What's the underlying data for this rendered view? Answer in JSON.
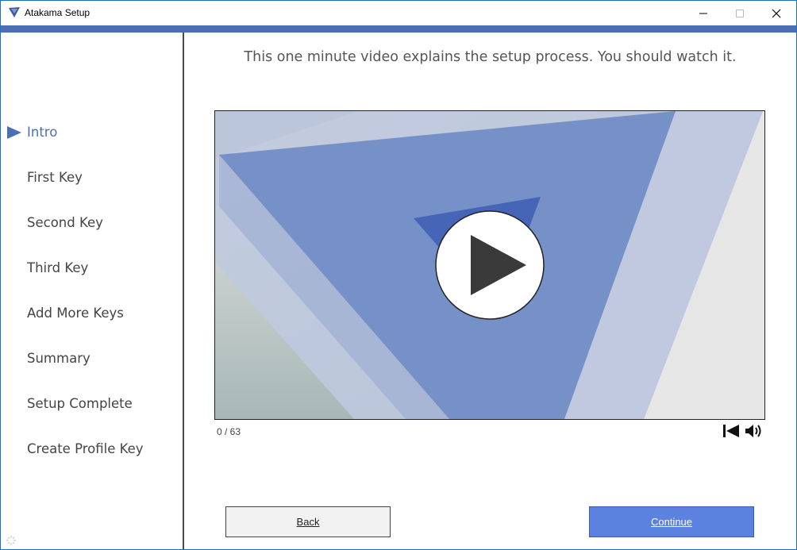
{
  "window": {
    "title": "Atakama Setup",
    "minimize_glyph": "—",
    "maximize_glyph": "☐",
    "close_glyph": "✕"
  },
  "colors": {
    "accent": "#4a6fb5",
    "continue_button": "#5b82de",
    "active_step": "#4a6fb5"
  },
  "sidebar": {
    "steps": [
      {
        "label": "Intro",
        "active": true
      },
      {
        "label": "First Key",
        "active": false
      },
      {
        "label": "Second Key",
        "active": false
      },
      {
        "label": "Third Key",
        "active": false
      },
      {
        "label": "Add More Keys",
        "active": false
      },
      {
        "label": "Summary",
        "active": false
      },
      {
        "label": "Setup Complete",
        "active": false
      },
      {
        "label": "Create Profile Key",
        "active": false
      }
    ]
  },
  "main": {
    "headline": "This one minute video explains the setup process. You should watch it.",
    "video": {
      "time_display": "0 / 63",
      "play_icon": "play-icon",
      "restart_icon": "skip-to-start-icon",
      "volume_icon": "volume-icon"
    },
    "buttons": {
      "back": "Back",
      "continue": "Continue"
    }
  }
}
